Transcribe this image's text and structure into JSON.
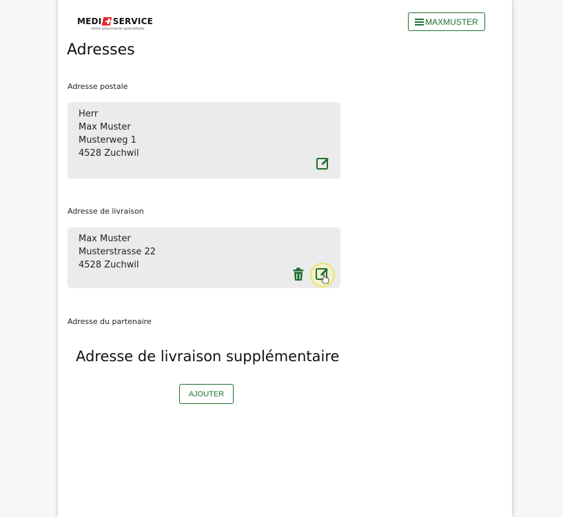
{
  "header": {
    "logo": {
      "word_left": "MEDI",
      "word_right": "SERVICE",
      "tagline": "Votre pharmacie spécialisée"
    },
    "user_button_label": "MAXMUSTER"
  },
  "page_title": "Adresses",
  "postal": {
    "label": "Adresse postale",
    "lines": [
      "Herr",
      "Max Muster",
      "Musterweg 1",
      "4528 Zuchwil"
    ]
  },
  "delivery": {
    "label": "Adresse de livraison",
    "lines": [
      "Max Muster",
      "Musterstrasse 22",
      "4528 Zuchwil"
    ]
  },
  "partner": {
    "label": "Adresse du partenaire"
  },
  "additional": {
    "heading": "Adresse de livraison supplémentaire",
    "add_label": "AJOUTER"
  },
  "colors": {
    "accent": "#1b6e2f",
    "card_bg": "#ebebeb",
    "brand_red": "#e5242b"
  },
  "icons": {
    "edit": "edit-icon",
    "delete": "trash-icon",
    "menu": "menu-icon"
  }
}
